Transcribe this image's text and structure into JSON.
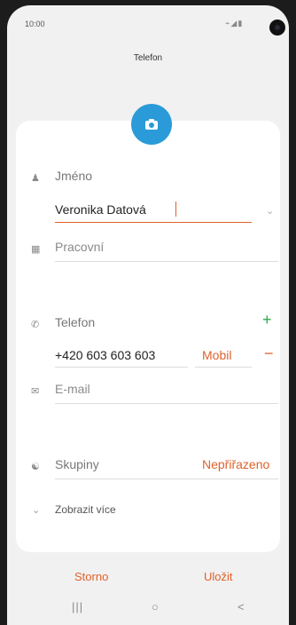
{
  "status_bar": {
    "time": "10:00",
    "icons": "⌁◢▮"
  },
  "header": {
    "title": "Telefon"
  },
  "photo": {
    "icon": "camera-icon",
    "color": "#2a9bd8"
  },
  "form": {
    "name_label": "Jméno",
    "name_value": "Veronika Datová",
    "organization_placeholder": "Pracovní",
    "phone_label": "Telefon",
    "phone_value": "+420 603 603 603",
    "phone_type": "Mobil",
    "email_placeholder": "E-mail",
    "groups_label": "Skupiny",
    "groups_value": "Nepřiřazeno",
    "show_more": "Zobrazit více"
  },
  "actions": {
    "cancel": "Storno",
    "save": "Uložit"
  },
  "nav": {
    "recent": "|||",
    "home": "○",
    "back": "<"
  },
  "colors": {
    "accent": "#e0622a",
    "add": "#2fa84a",
    "photo": "#2a9bd8"
  }
}
